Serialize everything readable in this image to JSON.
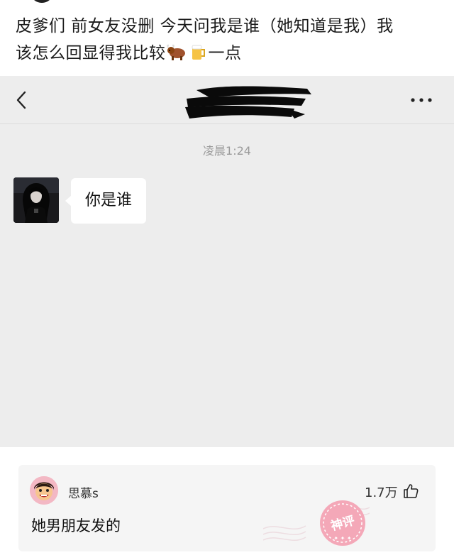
{
  "post": {
    "title_line1": "皮爹们 前女友没删 今天问我是谁（她知道是我）我",
    "title_line2_prefix": "该怎么回显得我比较",
    "title_emoji_1": "ox-emoji",
    "title_emoji_2": "beer-emoji",
    "title_line2_suffix": "一点"
  },
  "chat": {
    "timestamp": "凌晨1:24",
    "message": "你是谁"
  },
  "comment": {
    "username": "思慕s",
    "likes": "1.7万",
    "text": "她男朋友发的",
    "stamp_text": "神评"
  },
  "colors": {
    "chat_bg": "#ededed",
    "bubble_bg": "#ffffff",
    "stamp": "#f4a8b8"
  }
}
